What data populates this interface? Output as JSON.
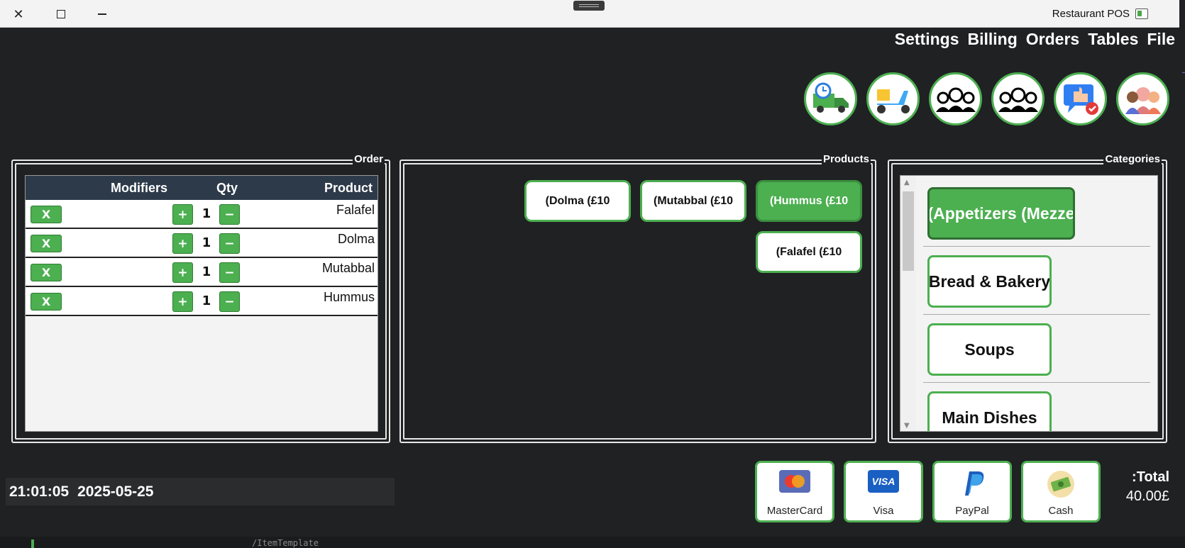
{
  "window": {
    "title": "Restaurant POS"
  },
  "menu": [
    "File",
    "Tables",
    "Orders",
    "Billing",
    "Settings"
  ],
  "actions": [
    "delivery-truck-icon",
    "scooter-icon",
    "group-icon",
    "group-check-icon",
    "feedback-icon",
    "customers-icon"
  ],
  "order": {
    "title": "Order",
    "columns": {
      "product": "Product",
      "qty": "Qty",
      "modifiers": "Modifiers"
    },
    "remove_label": "X",
    "plus_label": "+",
    "minus_label": "−",
    "rows": [
      {
        "product": "Falafel",
        "qty": "1"
      },
      {
        "product": "Dolma",
        "qty": "1"
      },
      {
        "product": "Mutabbal",
        "qty": "1"
      },
      {
        "product": "Hummus",
        "qty": "1"
      }
    ]
  },
  "products": {
    "title": "Products",
    "items": [
      {
        "label": "(Hummus (£10",
        "active": true
      },
      {
        "label": "(Mutabbal (£10",
        "active": false
      },
      {
        "label": "(Dolma (£10",
        "active": false
      },
      {
        "label": "(Falafel (£10",
        "active": false
      }
    ]
  },
  "categories": {
    "title": "Categories",
    "items": [
      {
        "label": "(Appetizers (Mezze",
        "active": true
      },
      {
        "label": "Bread & Bakery",
        "active": false
      },
      {
        "label": "Soups",
        "active": false
      },
      {
        "label": "Main Dishes",
        "active": false
      }
    ]
  },
  "clock": {
    "time": "21:01:05",
    "date": "2025-05-25"
  },
  "payments": [
    {
      "label": "MasterCard",
      "icon": "mastercard-icon"
    },
    {
      "label": "Visa",
      "icon": "visa-icon"
    },
    {
      "label": "PayPal",
      "icon": "paypal-icon"
    },
    {
      "label": "Cash",
      "icon": "cash-icon"
    }
  ],
  "total": {
    "label": ":Total",
    "value": "40.00£"
  },
  "background_text": "/ItemTemplate",
  "colors": {
    "accent": "#4caf50",
    "header": "#2d3a4a",
    "background": "#1f2123"
  }
}
